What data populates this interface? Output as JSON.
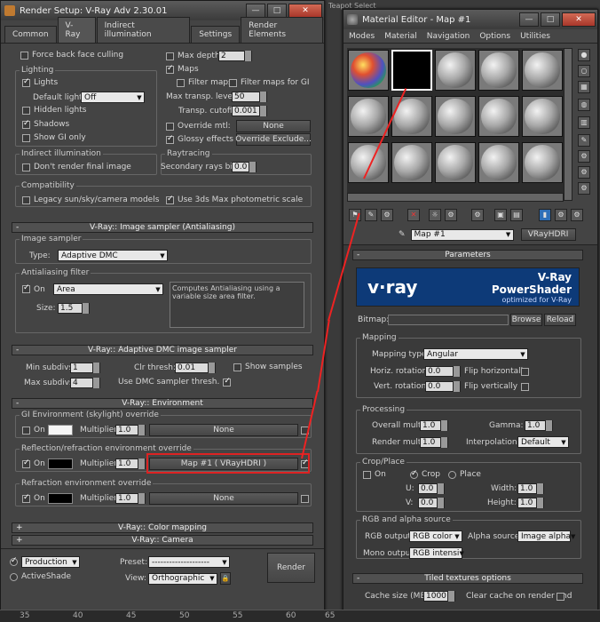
{
  "render_setup": {
    "title": "Render Setup: V-Ray Adv 2.30.01",
    "win_btn_min": "—",
    "win_btn_max": "□",
    "win_btn_close": "✕",
    "tabs": [
      "Common",
      "V-Ray",
      "Indirect illumination",
      "Settings",
      "Render Elements"
    ],
    "force_back_face": "Force back face culling",
    "max_depth": "Max depth",
    "max_depth_val": "2",
    "lighting_title": "Lighting",
    "lights": "Lights",
    "default_lights": "Default lights",
    "default_lights_val": "Off",
    "hidden_lights": "Hidden lights",
    "shadows": "Shadows",
    "show_gi_only": "Show GI only",
    "maps": "Maps",
    "filter_maps": "Filter maps",
    "filter_maps_gi": "Filter maps for GI",
    "max_transp": "Max transp. levels",
    "max_transp_val": "50",
    "transp_cutoff": "Transp. cutoff",
    "transp_cutoff_val": "0.001",
    "override_mtl": "Override mtl:",
    "override_none": "None",
    "glossy_effects": "Glossy effects",
    "override_exclude": "Override Exclude...",
    "indirect_title": "Indirect illumination",
    "dont_render_final": "Don't render final image",
    "raytracing_title": "Raytracing",
    "secondary_bias": "Secondary rays bias",
    "secondary_bias_val": "0.0",
    "compat_title": "Compatibility",
    "legacy_sun": "Legacy sun/sky/camera models",
    "use_3ds_phot": "Use 3ds Max photometric scale",
    "image_sampler_rollout": "V-Ray:: Image sampler (Antialiasing)",
    "image_sampler_title": "Image sampler",
    "type_label": "Type:",
    "type_val": "Adaptive DMC",
    "aa_filter_title": "Antialiasing filter",
    "aa_on": "On",
    "aa_filter_val": "Area",
    "aa_desc": "Computes Antialiasing using a variable size area filter.",
    "size_label": "Size:",
    "size_val": "1.5",
    "adaptive_rollout": "V-Ray:: Adaptive DMC image sampler",
    "min_subdivs": "Min subdivs",
    "min_subdivs_val": "1",
    "clr_thresh": "Clr thresh:",
    "clr_thresh_val": "0.01",
    "show_samples": "Show samples",
    "max_subdivs": "Max subdivs",
    "max_subdivs_val": "4",
    "use_dmc": "Use DMC sampler thresh.",
    "env_rollout": "V-Ray:: Environment",
    "gi_env_title": "GI Environment (skylight) override",
    "gi_on": "On",
    "gi_mult": "Multiplier:",
    "gi_mult_val": "1.0",
    "gi_none": "None",
    "refl_title": "Reflection/refraction environment override",
    "refl_on": "On",
    "refl_mult": "Multiplier:",
    "refl_mult_val": "1.0",
    "refl_map": "Map #1  ( VRayHDRI )",
    "refr_title": "Refraction environment override",
    "refr_on": "On",
    "refr_mult": "Multiplier:",
    "refr_mult_val": "1.0",
    "refr_none": "None",
    "color_mapping_rollout": "V-Ray:: Color mapping",
    "camera_rollout": "V-Ray:: Camera",
    "rollout_plus": "+",
    "rollout_minus": "-",
    "production": "Production",
    "activeshade": "ActiveShade",
    "preset_label": "Preset:",
    "preset_val": "--------------------",
    "view_label": "View:",
    "view_val": "Orthographic",
    "render_btn": "Render",
    "lock_icon_glyph": "🔒"
  },
  "material_editor": {
    "title": "Material Editor - Map #1",
    "menus": [
      "Modes",
      "Material",
      "Navigation",
      "Options",
      "Utilities"
    ],
    "map_name": "Map #1",
    "map_type": "VRayHDRI",
    "params_rollout": "Parameters",
    "vray_logo": "v·ray",
    "banner_title": "V-Ray PowerShader",
    "banner_sub": "optimized for V-Ray",
    "bitmap_label": "Bitmap:",
    "browse": "Browse",
    "reload": "Reload",
    "mapping_title": "Mapping",
    "mapping_type": "Mapping type:",
    "mapping_type_val": "Angular",
    "horiz_rot": "Horiz. rotation:",
    "horiz_rot_val": "0.0",
    "flip_h": "Flip horizontally",
    "vert_rot": "Vert. rotation:",
    "vert_rot_val": "0.0",
    "flip_v": "Flip vertically",
    "processing_title": "Processing",
    "overall_mult": "Overall mult:",
    "overall_mult_val": "1.0",
    "gamma": "Gamma:",
    "gamma_val": "1.0",
    "render_mult": "Render mult:",
    "render_mult_val": "1.0",
    "interpolation": "Interpolation:",
    "interpolation_val": "Default",
    "crop_title": "Crop/Place",
    "crop_on": "On",
    "crop": "Crop",
    "place": "Place",
    "u_label": "U:",
    "u_val": "0.0",
    "width_label": "Width:",
    "width_val": "1.0",
    "v_label": "V:",
    "v_val": "0.0",
    "height_label": "Height:",
    "height_val": "1.0",
    "rgb_title": "RGB and alpha source",
    "rgb_output": "RGB output:",
    "rgb_output_val": "RGB color",
    "alpha_source": "Alpha source:",
    "alpha_source_val": "Image alpha",
    "mono_output": "Mono output:",
    "mono_output_val": "RGB intensi",
    "tiled_rollout": "Tiled textures options",
    "cache_size": "Cache size (MB):",
    "cache_size_val": "1000",
    "clear_cache": "Clear cache on render end",
    "toolbar_glyphs": [
      "⚑",
      "✎",
      "⚙",
      "✕",
      "☼",
      "⚙",
      "⚙",
      "▣",
      "▤",
      "▮",
      "⚙",
      "⚙"
    ],
    "side_glyphs": [
      "●",
      "○",
      "▦",
      "◍",
      "▥",
      "✎",
      "⚙",
      "⚙",
      "⚙"
    ],
    "eyedrop_glyph": "✎"
  },
  "background": {
    "ruler_labels": [
      "35",
      "40",
      "45",
      "50",
      "55",
      "60",
      "65"
    ],
    "top_text": "Teapot Select"
  }
}
